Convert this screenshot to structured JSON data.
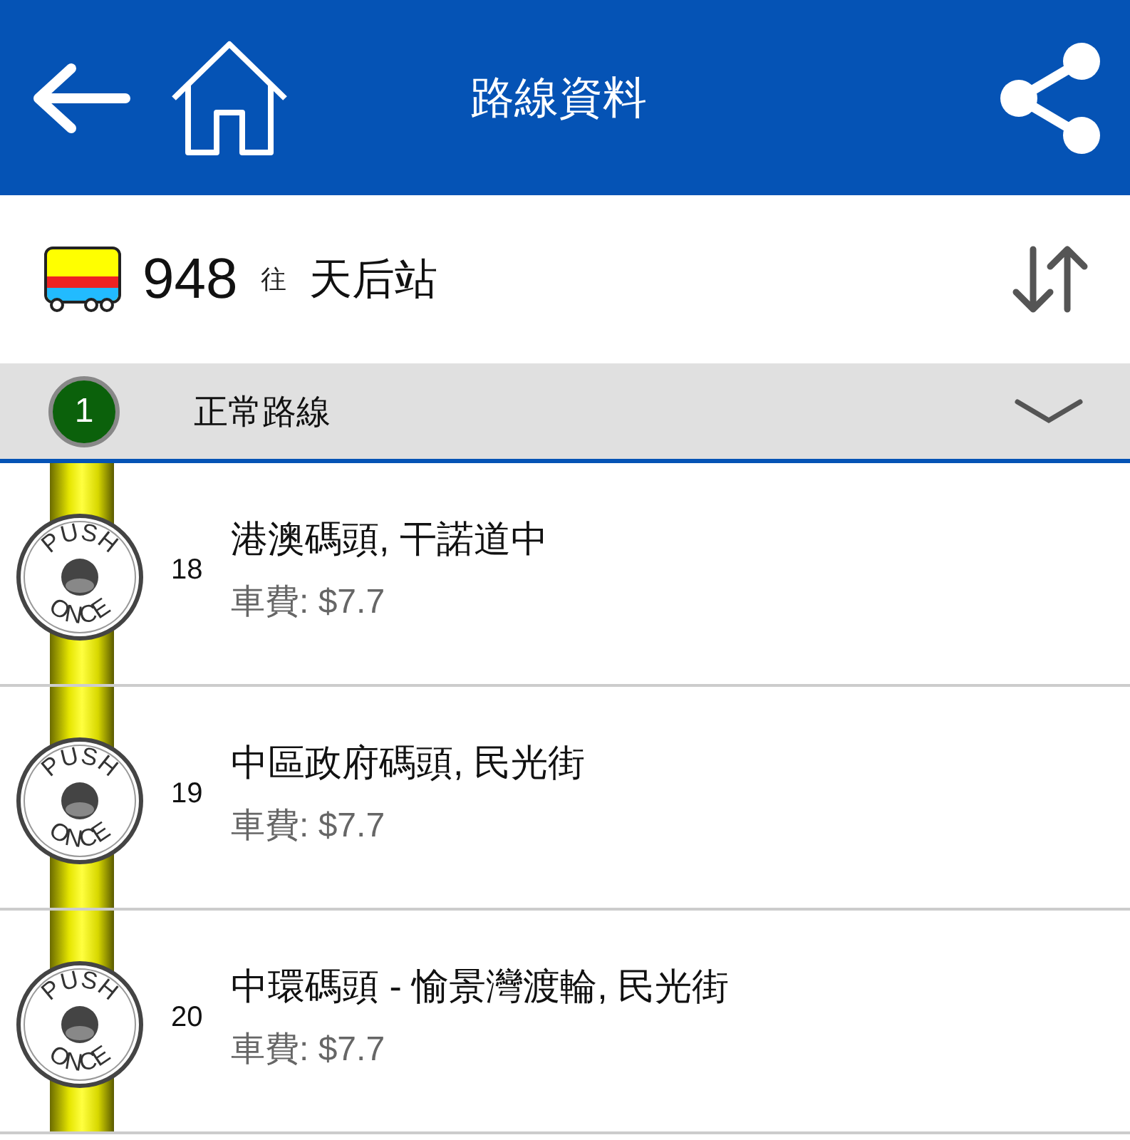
{
  "header": {
    "title": "路線資料"
  },
  "route": {
    "number": "948",
    "direction_label": "往",
    "destination": "天后站"
  },
  "variant": {
    "index": "1",
    "name": "正常路線",
    "expanded": false
  },
  "stops": [
    {
      "seq": "18",
      "name": "港澳碼頭, 干諾道中",
      "fare": "車費: $7.7",
      "button_top": "PUSH",
      "button_bottom": "ONCE"
    },
    {
      "seq": "19",
      "name": "中區政府碼頭, 民光街",
      "fare": "車費: $7.7",
      "button_top": "PUSH",
      "button_bottom": "ONCE"
    },
    {
      "seq": "20",
      "name": "中環碼頭 - 愉景灣渡輪, 民光街",
      "fare": "車費: $7.7",
      "button_top": "PUSH",
      "button_bottom": "ONCE"
    }
  ]
}
